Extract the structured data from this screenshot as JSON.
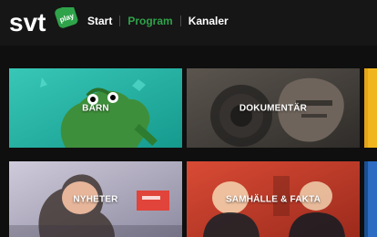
{
  "brand": {
    "logo_text": "svt",
    "badge_text": "play",
    "accent": "#2fa34a"
  },
  "nav": {
    "items": [
      {
        "label": "Start",
        "active": false
      },
      {
        "label": "Program",
        "active": true
      },
      {
        "label": "Kanaler",
        "active": false
      }
    ]
  },
  "categories": [
    {
      "label": "BARN",
      "color": "#2fb5a6"
    },
    {
      "label": "DOKUMENTÄR",
      "color": "#4a4641"
    },
    {
      "label": "NYHETER",
      "color": "#b9b4c7"
    },
    {
      "label": "SAMHÄLLE & FAKTA",
      "color": "#c83a2a"
    }
  ]
}
